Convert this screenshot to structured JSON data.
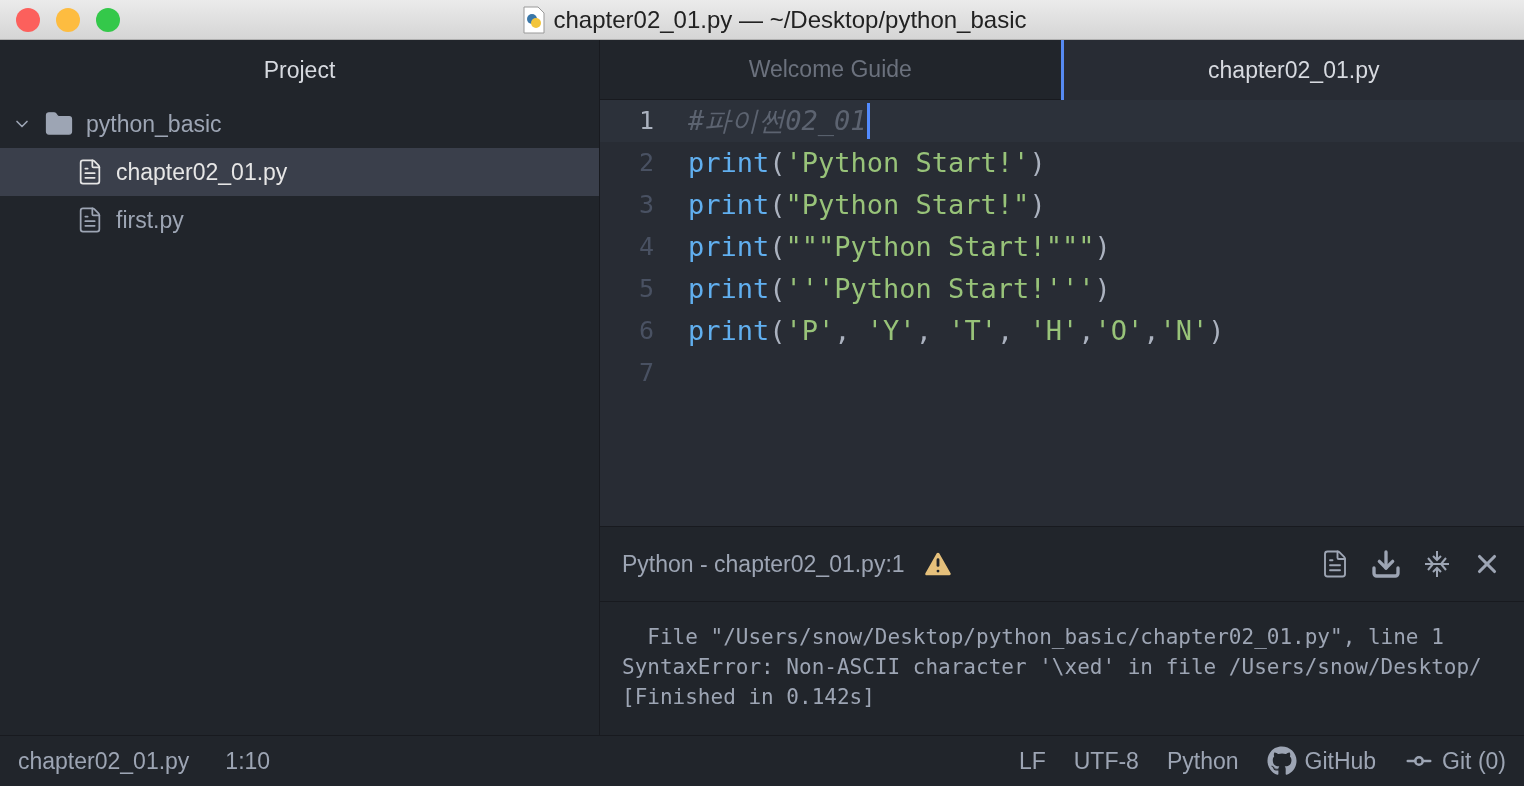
{
  "window": {
    "title": "chapter02_01.py — ~/Desktop/python_basic"
  },
  "sidebar": {
    "title": "Project",
    "tree": [
      {
        "name": "python_basic",
        "kind": "folder",
        "expanded": true,
        "selected": false,
        "children": [
          {
            "name": "chapter02_01.py",
            "kind": "file",
            "selected": true
          },
          {
            "name": "first.py",
            "kind": "file",
            "selected": false
          }
        ]
      }
    ]
  },
  "tabs": [
    {
      "label": "Welcome Guide",
      "selected": false
    },
    {
      "label": "chapter02_01.py",
      "selected": true
    }
  ],
  "editor": {
    "lines": [
      {
        "number": "1",
        "current": true,
        "tokens": [
          {
            "kind": "comment",
            "text": "#파이썬02_01"
          }
        ]
      },
      {
        "number": "2",
        "current": false,
        "tokens": [
          {
            "kind": "func",
            "text": "print"
          },
          {
            "kind": "punct",
            "text": "("
          },
          {
            "kind": "string",
            "text": "'Python Start!'"
          },
          {
            "kind": "punct",
            "text": ")"
          }
        ]
      },
      {
        "number": "3",
        "current": false,
        "tokens": [
          {
            "kind": "func",
            "text": "print"
          },
          {
            "kind": "punct",
            "text": "("
          },
          {
            "kind": "string",
            "text": "\"Python Start!\""
          },
          {
            "kind": "punct",
            "text": ")"
          }
        ]
      },
      {
        "number": "4",
        "current": false,
        "tokens": [
          {
            "kind": "func",
            "text": "print"
          },
          {
            "kind": "punct",
            "text": "("
          },
          {
            "kind": "string",
            "text": "\"\"\"Python Start!\"\"\""
          },
          {
            "kind": "punct",
            "text": ")"
          }
        ]
      },
      {
        "number": "5",
        "current": false,
        "tokens": [
          {
            "kind": "func",
            "text": "print"
          },
          {
            "kind": "punct",
            "text": "("
          },
          {
            "kind": "string",
            "text": "'''Python Start!'''"
          },
          {
            "kind": "punct",
            "text": ")"
          }
        ]
      },
      {
        "number": "6",
        "current": false,
        "tokens": [
          {
            "kind": "func",
            "text": "print"
          },
          {
            "kind": "punct",
            "text": "("
          },
          {
            "kind": "string",
            "text": "'P'"
          },
          {
            "kind": "punct",
            "text": ", "
          },
          {
            "kind": "string",
            "text": "'Y'"
          },
          {
            "kind": "punct",
            "text": ", "
          },
          {
            "kind": "string",
            "text": "'T'"
          },
          {
            "kind": "punct",
            "text": ", "
          },
          {
            "kind": "string",
            "text": "'H'"
          },
          {
            "kind": "punct",
            "text": ","
          },
          {
            "kind": "string",
            "text": "'O'"
          },
          {
            "kind": "punct",
            "text": ","
          },
          {
            "kind": "string",
            "text": "'N'"
          },
          {
            "kind": "punct",
            "text": ")"
          }
        ]
      },
      {
        "number": "7",
        "current": false
      }
    ]
  },
  "output_panel": {
    "title": "Python - chapter02_01.py:1",
    "lines": [
      "  File \"/Users/snow/Desktop/python_basic/chapter02_01.py\", line 1",
      "SyntaxError: Non-ASCII character '\\xed' in file /Users/snow/Desktop/",
      "[Finished in 0.142s]"
    ]
  },
  "status_bar": {
    "left": [
      "chapter02_01.py",
      "1:10"
    ],
    "right": [
      {
        "kind": "text",
        "label": "LF"
      },
      {
        "kind": "text",
        "label": "UTF-8"
      },
      {
        "kind": "text",
        "label": "Python"
      },
      {
        "kind": "github",
        "label": "GitHub"
      },
      {
        "kind": "git",
        "label": "Git (0)"
      }
    ]
  }
}
